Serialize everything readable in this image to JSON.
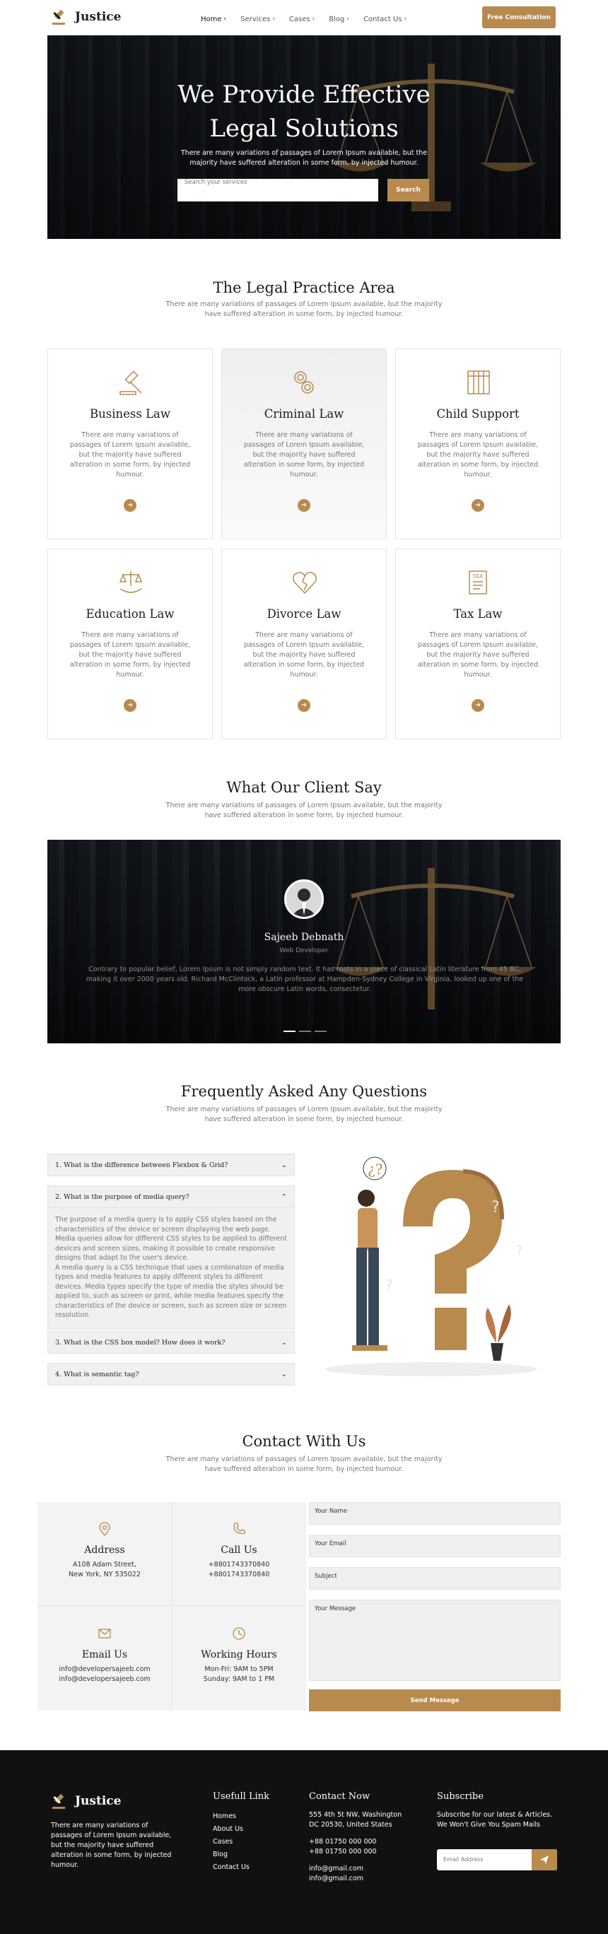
{
  "header": {
    "brand": "Justice",
    "nav": [
      {
        "label": "Home"
      },
      {
        "label": "Services"
      },
      {
        "label": "Cases"
      },
      {
        "label": "Blog"
      },
      {
        "label": "Contact Us"
      }
    ],
    "cta": "Free Consultation"
  },
  "hero": {
    "title_line1": "We Provide Effective",
    "title_line2": "Legal Solutions",
    "subtitle": "There are many variations of passages of Lorem Ipsum available, but the majority have suffered alteration in some form, by injected humour.",
    "search_placeholder": "Search your services",
    "search_button": "Search"
  },
  "practice": {
    "title": "The Legal Practice Area",
    "subtitle": "There are many variations of passages of Lorem Ipsum available, but the majority have suffered alteration in some form, by injected humour.",
    "cards": [
      {
        "title": "Business Law",
        "text": "There are many variations of passages of Lorem Ipsum available, but the majority have suffered alteration in some form, by injected humour.",
        "icon": "gavel-icon"
      },
      {
        "title": "Criminal Law",
        "text": "There are many variations of passages of Lorem Ipsum available, but the majority have suffered alteration in some form, by injected humour.",
        "icon": "handcuffs-icon"
      },
      {
        "title": "Child Support",
        "text": "There are many variations of passages of Lorem Ipsum available, but the majority have suffered alteration in some form, by injected humour.",
        "icon": "jail-icon"
      },
      {
        "title": "Education Law",
        "text": "There are many variations of passages of Lorem Ipsum available, but the majority have suffered alteration in some form, by injected humour.",
        "icon": "scales-hand-icon"
      },
      {
        "title": "Divorce Law",
        "text": "There are many variations of passages of Lorem Ipsum available, but the majority have suffered alteration in some form, by injected humour.",
        "icon": "broken-heart-icon"
      },
      {
        "title": "Tax Law",
        "text": "There are many variations of passages of Lorem Ipsum available, but the majority have suffered alteration in some form, by injected humour.",
        "icon": "tax-document-icon"
      }
    ]
  },
  "testimonials": {
    "title": "What Our Client Say",
    "subtitle": "There are many variations of passages of Lorem Ipsum available, but the majority have suffered alteration in some form, by injected humour.",
    "name": "Sajeeb Debnath",
    "role": "Web Developer",
    "quote": "Contrary to popular belief, Lorem Ipsum is not simply random text. It has roots in a piece of classical Latin literature from 45 BC, making it over 2000 years old. Richard McClintock, a Latin professor at Hampden-Sydney College in Virginia, looked up one of the more obscure Latin words, consectetur."
  },
  "faq": {
    "title": "Frequently Asked Any Questions",
    "subtitle": "There are many variations of passages of Lorem Ipsum available, but the majority have suffered alteration in some form, by injected humour.",
    "items": [
      {
        "q": "1. What is the difference between Flexbox & Grid?"
      },
      {
        "q": "2. What is the purpose of media query?",
        "a": "The purpose of a media query is to apply CSS styles based on the characteristics of the device or screen displaying the web page. Media queries allow for different CSS styles to be applied to different devices and screen sizes, making it possible to create responsive designs that adapt to the user's device.\nA media query is a CSS technique that uses a combination of media types and media features to apply different styles to different devices. Media types specify the type of media the styles should be applied to, such as screen or print, while media features specify the characteristics of the device or screen, such as screen size or screen resolution."
      },
      {
        "q": "3. What is the CSS box model? How does it work?"
      },
      {
        "q": "4. What is semantic tag?"
      }
    ]
  },
  "contact": {
    "title": "Contact With Us",
    "subtitle": "There are many variations of passages of Lorem Ipsum available, but the majority have suffered alteration in some form, by injected humour.",
    "address": {
      "label": "Address",
      "line1": "A108 Adam Street,",
      "line2": "New York, NY 535022"
    },
    "call": {
      "label": "Call Us",
      "line1": "+8801743370840",
      "line2": "+8801743370840"
    },
    "email": {
      "label": "Email Us",
      "line1": "info@developersajeeb.com",
      "line2": "info@developersajeeb.com"
    },
    "hours": {
      "label": "Working Hours",
      "line1": "Mon-Fri: 9AM to 5PM",
      "line2": "Sunday: 9AM to 1 PM"
    },
    "form": {
      "name": "Your Name",
      "email": "Your Email",
      "subject": "Subject",
      "message": "Your Message",
      "send": "Send Message"
    }
  },
  "footer": {
    "brand": "Justice",
    "about": "There are many variations of passages of Lorem Ipsum available, but the majority have suffered alteration in some form, by injected humour.",
    "links_title": "Usefull Link",
    "links": [
      "Homes",
      "About Us",
      "Cases",
      "Blog",
      "Contact Us"
    ],
    "contact_title": "Contact Now",
    "contact_address": "555 4th 5t NW, Washington DC 20530, United States",
    "phone1": "+88 01750 000 000",
    "phone2": "+88 01750 000 000",
    "mail1": "info@gmail.com",
    "mail2": "info@gmail.com",
    "subscribe_title": "Subscribe",
    "subscribe_text": "Subscribe for our latest & Articles. We Won't Give You Spam Mails",
    "email_placeholder": "Email Address"
  },
  "colors": {
    "accent": "#b88a4e",
    "dark": "#111111",
    "text": "#1c1c1c"
  }
}
